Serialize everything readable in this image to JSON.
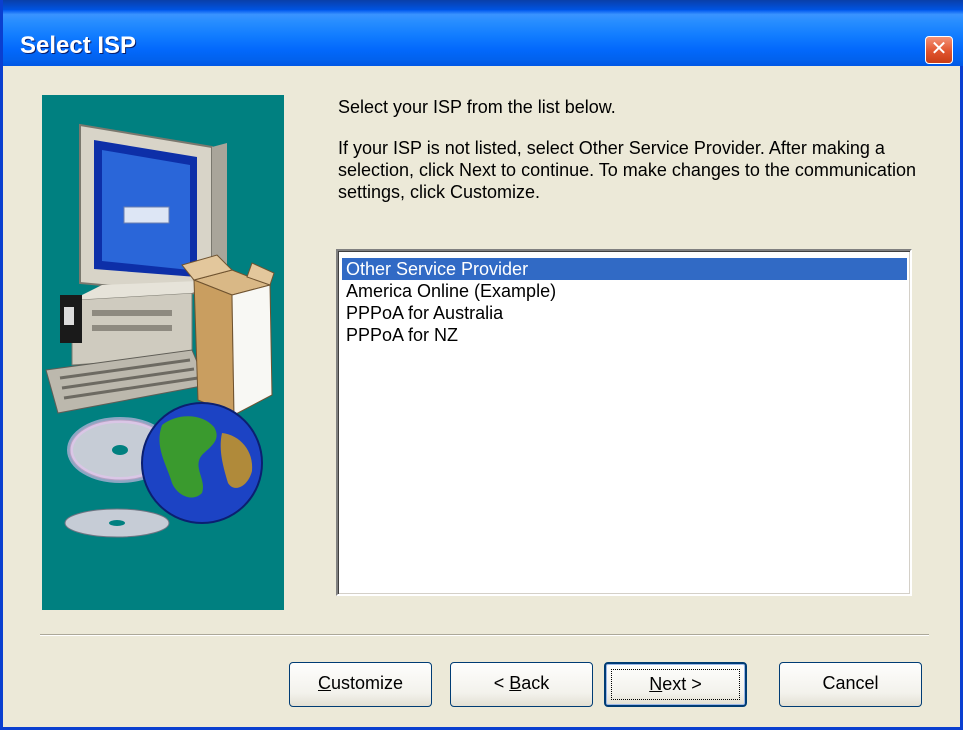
{
  "window": {
    "title": "Select ISP",
    "close_glyph": "✕"
  },
  "instructions": {
    "line1": "Select your ISP from the list below.",
    "line2": "If your ISP is not listed, select Other Service Provider.  After making a selection, click Next to continue.  To make changes to the communication settings, click Customize."
  },
  "isp_list": {
    "items": [
      {
        "label": "Other Service Provider",
        "selected": true
      },
      {
        "label": "America Online (Example)",
        "selected": false
      },
      {
        "label": "PPPoA for Australia",
        "selected": false
      },
      {
        "label": "PPPoA for NZ",
        "selected": false
      }
    ]
  },
  "buttons": {
    "customize": {
      "mnemonic": "C",
      "rest": "ustomize"
    },
    "back": {
      "prefix": "< ",
      "mnemonic": "B",
      "rest": "ack"
    },
    "next": {
      "mnemonic": "N",
      "rest": "ext >"
    },
    "cancel": {
      "label": "Cancel"
    }
  },
  "colors": {
    "title_bar": "#0058ee",
    "dialog_bg": "#ece9d8",
    "art_bg": "#008080",
    "selection": "#316ac5",
    "close_button": "#e1542e"
  },
  "icons": {
    "close": "close-icon",
    "art": "computer-globe-cd-illustration"
  }
}
